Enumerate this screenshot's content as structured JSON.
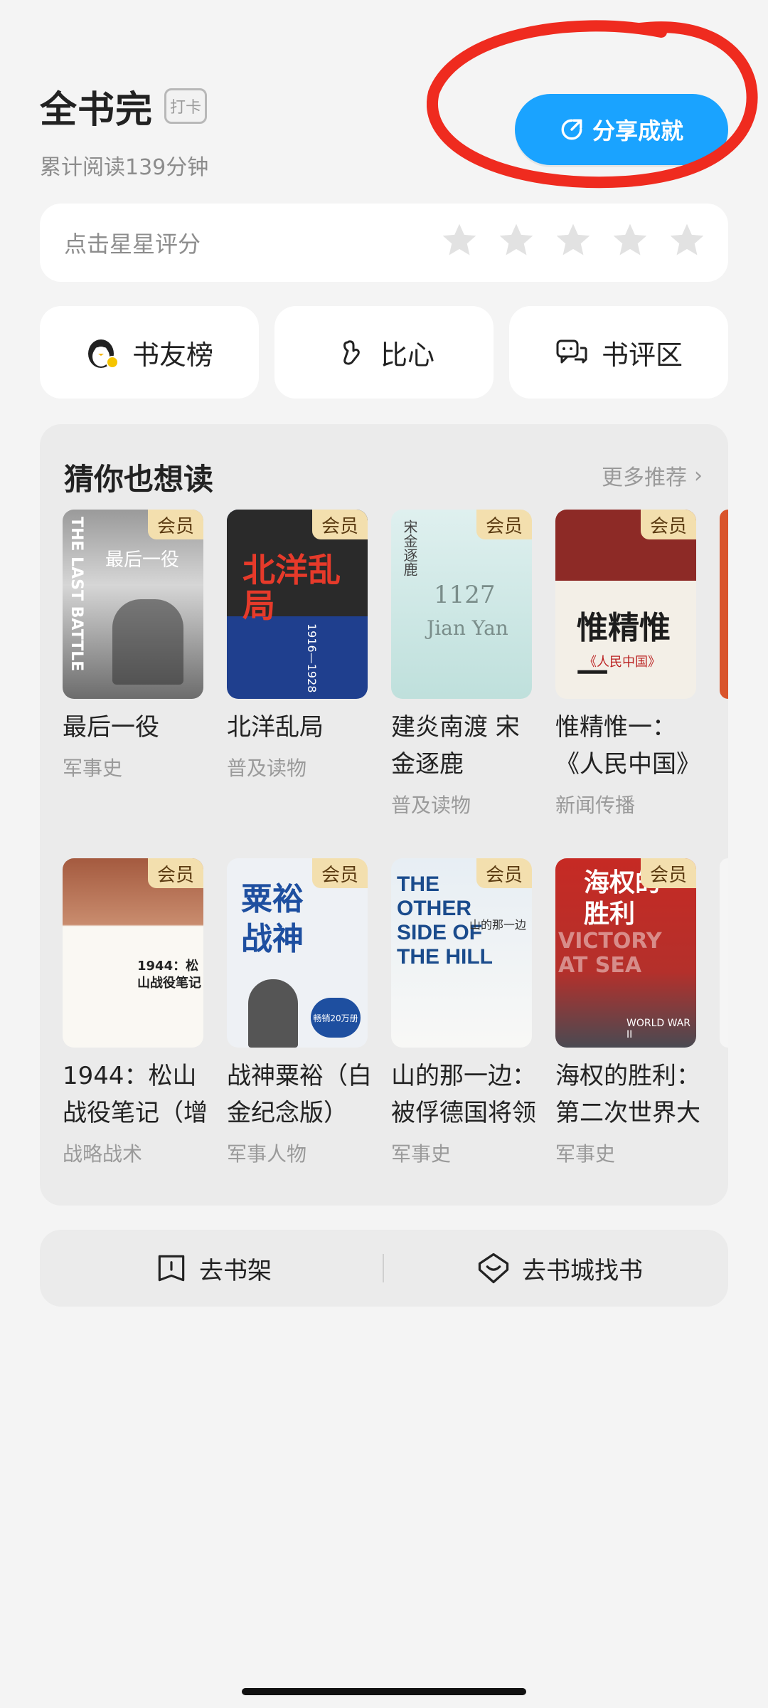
{
  "header": {
    "title": "全书完",
    "checkin_label": "打卡",
    "subtitle": "累计阅读139分钟",
    "share_label": "分享成就"
  },
  "rating": {
    "label": "点击星星评分",
    "stars": 5
  },
  "quick_actions": [
    {
      "label": "书友榜",
      "icon": "penguin-avatar-icon"
    },
    {
      "label": "比心",
      "icon": "heart-hand-icon"
    },
    {
      "label": "书评区",
      "icon": "chat-bubble-icon"
    }
  ],
  "recommend": {
    "title": "猜你也想读",
    "more_label": "更多推荐",
    "badge_label": "会员",
    "row1": [
      {
        "title": "最后一役",
        "category": "军事史"
      },
      {
        "title": "北洋乱局",
        "category": "普及读物"
      },
      {
        "title": "建炎南渡 宋金逐鹿",
        "category": "普及读物"
      },
      {
        "title": "惟精惟一：《人民中国》",
        "category": "新闻传播"
      }
    ],
    "row2": [
      {
        "title": "1944：松山战役笔记（增",
        "category": "战略战术"
      },
      {
        "title": "战神粟裕（白金纪念版）",
        "category": "军事人物"
      },
      {
        "title": "山的那一边：被俘德国将领",
        "category": "军事史"
      },
      {
        "title": "海权的胜利：第二次世界大",
        "category": "军事史"
      }
    ],
    "cover_texts": {
      "b1_spine": "THE LAST BATTLE",
      "b1_title": "最后一役",
      "b2_title": "北洋乱局",
      "b2_years": "1916—1928",
      "b3_title": "宋金逐鹿",
      "b3_year": "1127",
      "b3_sub": "Jian Yan",
      "b4_title": "惟精惟一",
      "b4_sub": "《人民中国》",
      "b5_title": "1944：松山战役笔记",
      "b6_title": "粟裕 战神",
      "b6_badge": "畅销20万册",
      "b7_en": "THE OTHER SIDE OF THE HILL",
      "b7_cn": "山的那一边",
      "b8_title": "海权的胜利",
      "b8_en": "VICTORY AT SEA",
      "b8_sub": "WORLD WAR II"
    }
  },
  "bottom": {
    "bookshelf_label": "去书架",
    "store_label": "去书城找书"
  },
  "colors": {
    "accent_blue": "#1aa3ff",
    "annotation_red": "#ef2b1f",
    "badge_gold": "#f3dfae"
  }
}
